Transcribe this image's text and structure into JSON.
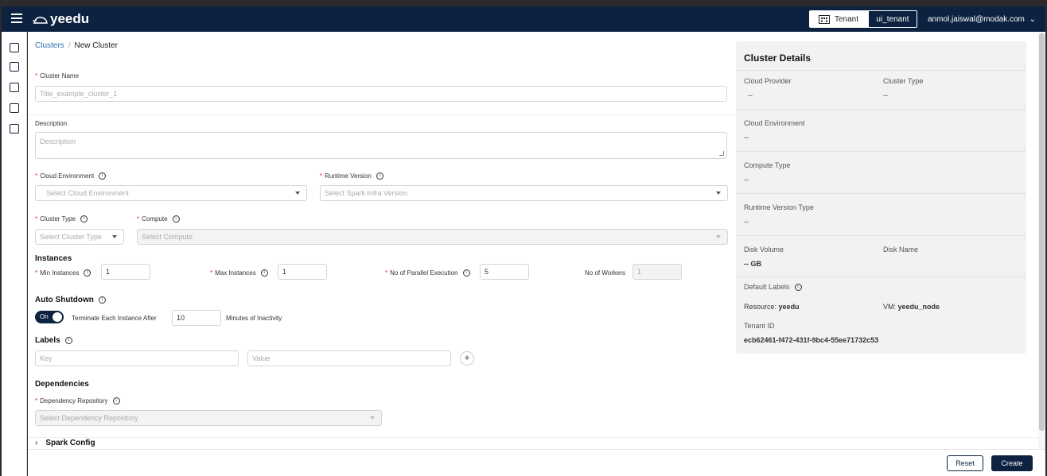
{
  "app": {
    "logo_text": "yeedu"
  },
  "header": {
    "tenant_label": "Tenant",
    "tenant_value": "ui_tenant",
    "user_email": "anmol.jaiswal@modak.com"
  },
  "breadcrumb": {
    "root": "Clusters",
    "separator": "/",
    "current": "New Cluster"
  },
  "form": {
    "cluster_name": {
      "label": "Cluster Name",
      "placeholder": "Title_example_cluster_1"
    },
    "description": {
      "label": "Description",
      "placeholder": "Description"
    },
    "cloud_environment": {
      "label": "Cloud Environment",
      "placeholder": "Select Cloud Environment"
    },
    "runtime_version": {
      "label": "Runtime Version",
      "placeholder": "Select Spark Infra Version"
    },
    "cluster_type": {
      "label": "Cluster Type",
      "placeholder": "Select Cluster Type"
    },
    "compute": {
      "label": "Compute",
      "placeholder": "Select Compute"
    },
    "instances": {
      "title": "Instances",
      "min_label": "Min Instances",
      "min_value": "1",
      "max_label": "Max Instances",
      "max_value": "1",
      "parallel_label": "No of Parallel Execution",
      "parallel_value": "5",
      "workers_label": "No of Workers",
      "workers_value": "1"
    },
    "auto_shutdown": {
      "title": "Auto Shutdown",
      "toggle_label": "On",
      "terminate_label": "Terminate Each Instance After",
      "minutes_value": "10",
      "minutes_suffix": "Minutes of Inactivity"
    },
    "labels": {
      "title": "Labels",
      "key_placeholder": "Key",
      "value_placeholder": "Value",
      "add": "+"
    },
    "dependencies": {
      "title": "Dependencies",
      "repo_label": "Dependency Repository",
      "repo_placeholder": "Select Dependency Repository"
    },
    "spark_config": {
      "title": "Spark Config",
      "chevron": "›"
    }
  },
  "details": {
    "title": "Cluster Details",
    "cloud_provider_label": "Cloud Provider",
    "cloud_provider_value": "--",
    "cluster_type_label": "Cluster Type",
    "cluster_type_value": "--",
    "cloud_env_label": "Cloud Environment",
    "cloud_env_value": "--",
    "compute_type_label": "Compute Type",
    "compute_type_value": "--",
    "runtime_type_label": "Runtime Version Type",
    "runtime_type_value": "--",
    "disk_volume_label": "Disk Volume",
    "disk_volume_value": "-- GB",
    "disk_name_label": "Disk Name",
    "default_labels_label": "Default Labels",
    "resource_label": "Resource:",
    "resource_value": "yeedu",
    "vm_label": "VM:",
    "vm_value": "yeedu_node",
    "tenant_id_label": "Tenant ID",
    "tenant_id_value": "ecb62461-f472-431f-9bc4-55ee71732c53"
  },
  "footer": {
    "reset": "Reset",
    "create": "Create"
  },
  "colors": {
    "primary": "#0d2240",
    "required": "#d32f2f",
    "link": "#2f6fb0"
  }
}
